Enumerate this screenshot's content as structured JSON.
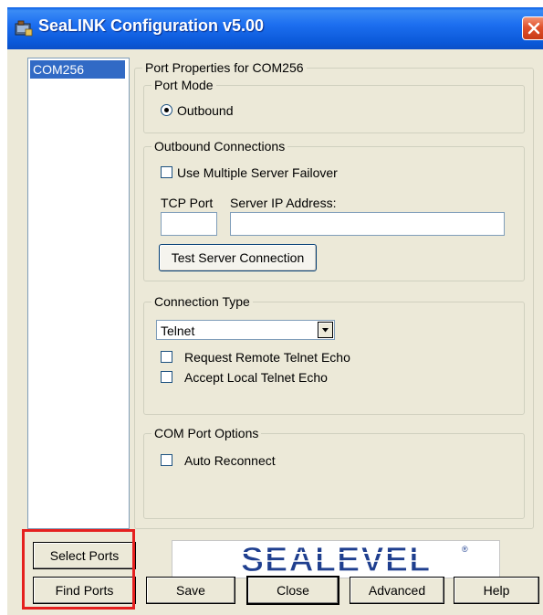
{
  "window": {
    "title": "SeaLINK Configuration v5.00"
  },
  "port_list": {
    "items": [
      "COM256"
    ],
    "selected": "COM256"
  },
  "port_properties": {
    "title": "Port Properties for COM256",
    "port_mode": {
      "label": "Port  Mode",
      "option": "Outbound",
      "selected": true
    },
    "outbound": {
      "label": "Outbound Connections",
      "multiple_failover_label": "Use Multiple Server Failover",
      "multiple_failover_checked": false,
      "tcp_port_label": "TCP Port",
      "tcp_port_value": "",
      "server_ip_label": "Server IP Address:",
      "server_ip_value": "",
      "test_button": "Test Server Connection"
    },
    "connection_type": {
      "label": "Connection Type",
      "selected": "Telnet",
      "request_echo_label": "Request Remote Telnet Echo",
      "request_echo_checked": false,
      "accept_echo_label": "Accept Local Telnet Echo",
      "accept_echo_checked": false
    },
    "com_options": {
      "label": "COM Port Options",
      "auto_reconnect_label": "Auto Reconnect",
      "auto_reconnect_checked": false
    }
  },
  "buttons": {
    "select_ports": "Select Ports",
    "find_ports": "Find Ports",
    "save": "Save",
    "close": "Close",
    "advanced": "Advanced",
    "help": "Help"
  },
  "logo": {
    "text": "SEALEVEL",
    "registered": "®",
    "color": "#1f3f8f"
  },
  "colors": {
    "titlebar": "#0a58d8",
    "highlight": "#e5201f",
    "selection": "#316ac5"
  }
}
